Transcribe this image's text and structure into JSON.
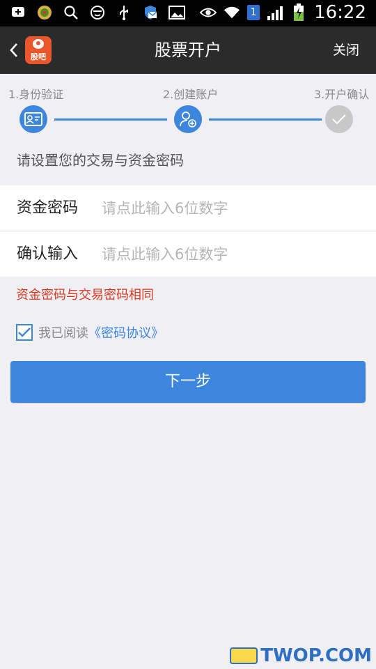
{
  "status_bar": {
    "time": "16:22",
    "sim_badge": "1",
    "icons": [
      "message-icon",
      "game-app-icon",
      "search-icon",
      "face-icon",
      "usb-icon",
      "shield-mail-icon",
      "image-icon",
      "eye-icon",
      "wifi-icon",
      "signal-icon",
      "battery-charging-icon"
    ]
  },
  "header": {
    "title": "股票开户",
    "logo_text": "股吧",
    "close_label": "关闭"
  },
  "steps": [
    {
      "label": "1.身份验证",
      "state": "done"
    },
    {
      "label": "2.创建账户",
      "state": "active"
    },
    {
      "label": "3.开户确认",
      "state": "pending"
    }
  ],
  "instruction": "请设置您的交易与资金密码",
  "form": {
    "fund_password": {
      "label": "资金密码",
      "placeholder": "请点此输入6位数字",
      "value": ""
    },
    "confirm_password": {
      "label": "确认输入",
      "placeholder": "请点此输入6位数字",
      "value": ""
    }
  },
  "notice": "资金密码与交易密码相同",
  "agreement": {
    "checked": true,
    "text": "我已阅读",
    "link": "《密码协议》"
  },
  "next_button": "下一步",
  "watermark": "TWOP.COM",
  "colors": {
    "accent": "#3d86dd",
    "title_bar": "#2b2b2b",
    "notice": "#d9391f",
    "background": "#efeff4"
  }
}
